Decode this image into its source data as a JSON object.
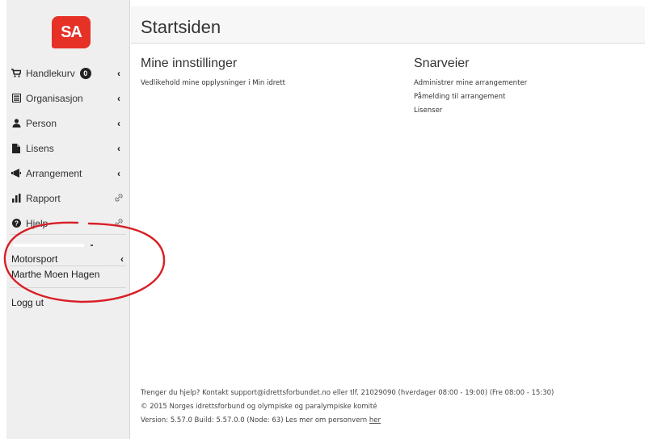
{
  "brand": {
    "logo_text": "SA",
    "color": "#e63127"
  },
  "sidebar": {
    "items": [
      {
        "label": "Handlekurv",
        "icon": "cart-icon",
        "badge": "0",
        "indicator": "‹"
      },
      {
        "label": "Organisasjon",
        "icon": "list-icon",
        "indicator": "‹"
      },
      {
        "label": "Person",
        "icon": "person-icon",
        "indicator": "‹"
      },
      {
        "label": "Lisens",
        "icon": "document-icon",
        "indicator": "‹"
      },
      {
        "label": "Arrangement",
        "icon": "megaphone-icon",
        "indicator": "‹"
      },
      {
        "label": "Rapport",
        "icon": "bar-chart-icon",
        "indicator": "link"
      },
      {
        "label": "Hjelp",
        "icon": "question-icon",
        "indicator": "link"
      }
    ],
    "user": {
      "org": "Motorsport",
      "org_indicator": "‹",
      "name": "Marthe Moen Hagen"
    },
    "logout_label": "Logg ut"
  },
  "header": {
    "title": "Startsiden"
  },
  "main": {
    "settings": {
      "title": "Mine innstillinger",
      "links": [
        "Vedlikehold mine opplysninger i Min idrett"
      ]
    },
    "shortcuts": {
      "title": "Snarveier",
      "links": [
        "Administrer mine arrangementer",
        "Påmelding til arrangement",
        "Lisenser"
      ]
    }
  },
  "footer": {
    "help": "Trenger du hjelp? Kontakt support@idrettsforbundet.no eller tlf. 21029090 (hverdager 08:00 - 19:00) (Fre 08:00 - 15:30)",
    "copyright": "© 2015 Norges idrettsforbund og olympiske og paralympiske komité",
    "version_prefix": "Version: 5.57.0 Build: 5.57.0.0 (Node: 63) Les mer om personvern ",
    "version_link": "her"
  },
  "annotation": {
    "shape": "ellipse",
    "color": "#d81f26"
  }
}
